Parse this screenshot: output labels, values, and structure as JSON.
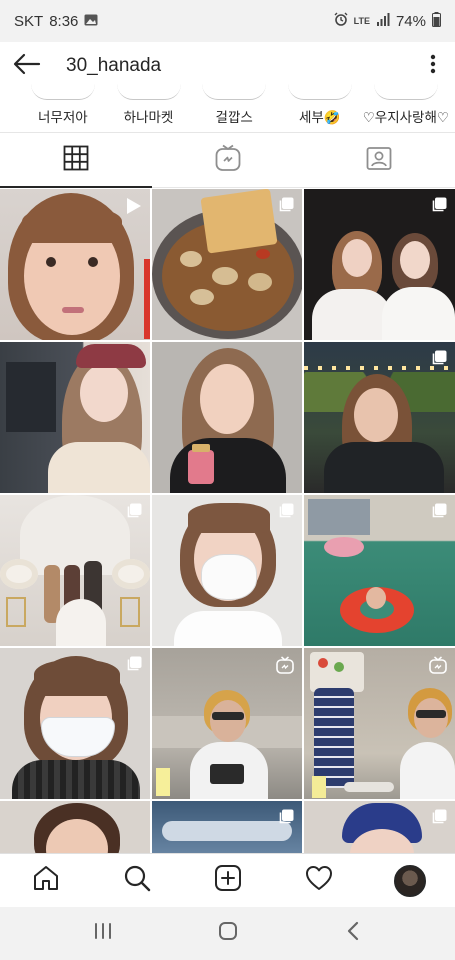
{
  "status": {
    "carrier": "SKT",
    "time": "8:36",
    "network": "LTE",
    "battery": "74%"
  },
  "header": {
    "username": "30_hanada"
  },
  "highlights": [
    {
      "label": "너무저아"
    },
    {
      "label": "하나마켓"
    },
    {
      "label": "걸깝스"
    },
    {
      "label": "세부🤣"
    },
    {
      "label": "♡우지사랑해♡"
    }
  ],
  "tabs": [
    {
      "name": "grid",
      "icon": "grid-icon",
      "active": true
    },
    {
      "name": "igtv",
      "icon": "igtv-icon",
      "active": false
    },
    {
      "name": "tagged",
      "icon": "tagged-icon",
      "active": false
    }
  ],
  "grid": {
    "posts": [
      {
        "type": "video",
        "desc": "selfie-face"
      },
      {
        "type": "carousel",
        "desc": "food-dish"
      },
      {
        "type": "carousel",
        "desc": "two-women"
      },
      {
        "type": "photo",
        "desc": "window-selfie"
      },
      {
        "type": "photo",
        "desc": "holding-product"
      },
      {
        "type": "carousel",
        "desc": "night-garden"
      },
      {
        "type": "carousel",
        "desc": "wedding"
      },
      {
        "type": "carousel",
        "desc": "mask-selfie"
      },
      {
        "type": "carousel",
        "desc": "pool-float"
      },
      {
        "type": "carousel",
        "desc": "mask-closeup"
      },
      {
        "type": "igtv",
        "desc": "live-stream"
      },
      {
        "type": "igtv",
        "desc": "live-stream-2"
      },
      {
        "type": "photo",
        "desc": "partial-1"
      },
      {
        "type": "carousel",
        "desc": "partial-2"
      },
      {
        "type": "carousel",
        "desc": "partial-3"
      }
    ]
  },
  "bottom_nav": [
    {
      "icon": "home-icon"
    },
    {
      "icon": "search-icon"
    },
    {
      "icon": "add-post-icon"
    },
    {
      "icon": "heart-icon"
    },
    {
      "icon": "profile-avatar"
    }
  ],
  "colors": {
    "text": "#262626",
    "border": "#e6e6e6",
    "status_bg": "#f2f2f2"
  }
}
